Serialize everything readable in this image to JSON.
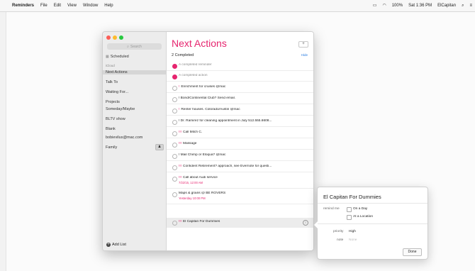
{
  "menubar": {
    "app": "Reminders",
    "items": [
      "File",
      "Edit",
      "View",
      "Window",
      "Help"
    ],
    "battery": "100%",
    "clock": "Sat 1:36 PM",
    "user": "ElCapitan"
  },
  "window": {
    "search_placeholder": "Search",
    "sidebar": {
      "scheduled": "Scheduled",
      "section": "iCloud",
      "lists": [
        "Next Actions",
        "Talk To",
        "Waiting For...",
        "Projects",
        "Someday/Maybe",
        "BLTV show",
        "Blank",
        "bobievilus@mac.com",
        "Family"
      ],
      "add_list": "Add List"
    },
    "main": {
      "title": "Next Actions",
      "add_label": "+",
      "completed": "2 Completed",
      "hide": "Hide",
      "rows": [
        {
          "text": "A completed reminder",
          "done": true
        },
        {
          "text": "A completed action",
          "done": true
        },
        {
          "prio": "!",
          "text": "Enrichment for cruises @mac"
        },
        {
          "text": "! Bond/Continental Club? Send email."
        },
        {
          "prio": "!",
          "text": "Renter houses. Colorado/Austin @mac"
        },
        {
          "text": "! Dr. Ramirez for cleaning appointment in July 512.555.6608..."
        },
        {
          "prio": "!!!",
          "text": "Call Mitch C."
        },
        {
          "prio": "!!!",
          "text": "Massage"
        },
        {
          "text": "! Mail Chimp or Eloqua? @mac"
        },
        {
          "prio": "!!!",
          "text": "Confident Retirement? approach, see Evernote for questi..."
        },
        {
          "prio": "!!!",
          "text": "Call about Audi service",
          "sub": "7/22/15, 12:00 AM"
        },
        {
          "text": "Maps & grains @ BE ROVERS",
          "sub": "Yesterday 10:00 PM"
        },
        {
          "prio": "!!!",
          "text": "El Capitan For Dummies",
          "selected": true
        }
      ]
    }
  },
  "popover": {
    "title": "El Capitan For Dummies",
    "remind_label": "remind me",
    "on_day": "On a Day",
    "at_location": "At a Location",
    "priority_label": "priority",
    "priority_value": "High",
    "note_label": "note",
    "note_placeholder": "None",
    "done": "Done"
  },
  "colors": {
    "accent": "#e6256f"
  }
}
